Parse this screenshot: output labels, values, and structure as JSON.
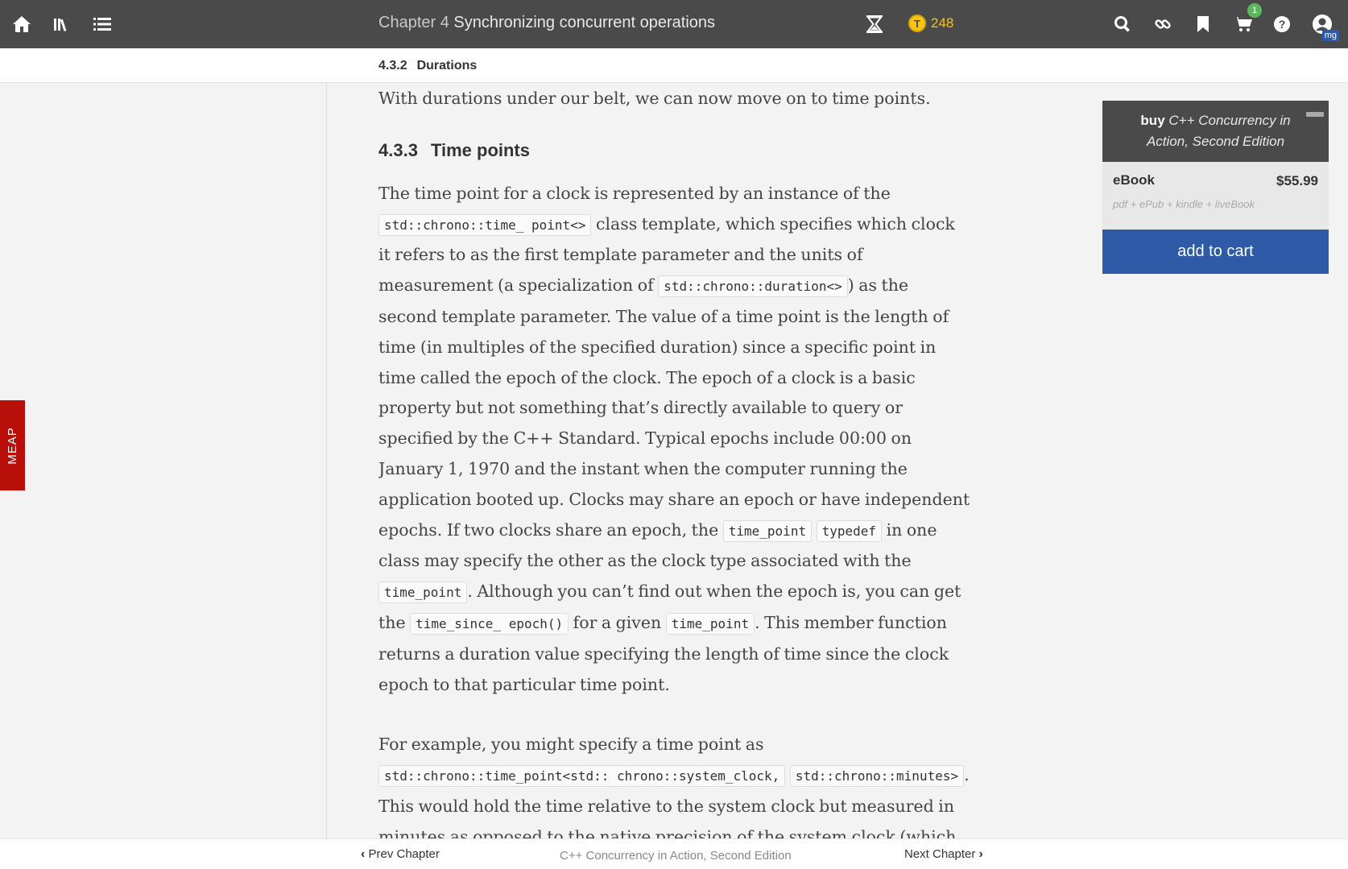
{
  "topbar": {
    "chapter_prefix": "Chapter 4",
    "chapter_title": "Synchronizing concurrent operations",
    "token_count": "248",
    "token_symbol": "T",
    "cart_count": "1",
    "avatar_initials": "mg",
    "icons": [
      "home-icon",
      "library-icon",
      "toc-list-icon",
      "hourglass-icon",
      "search-icon",
      "link-icon",
      "bookmark-icon",
      "cart-icon",
      "help-icon",
      "user-icon"
    ]
  },
  "subheader": {
    "section_number": "4.3.2",
    "section_title": "Durations"
  },
  "meap": {
    "label": "MEAP"
  },
  "content": {
    "intro": "With durations under our belt, we can now move on to time points.",
    "heading_number": "4.3.3",
    "heading_title": "Time points",
    "p1": {
      "t1": "The time point for a clock is represented by an instance of the ",
      "c1": "std::chrono::time_ point<>",
      "t2": " class template, which specifies which clock it refers to as the first template parameter and the units of measurement (a specialization of ",
      "c2": "std::chrono::duration<>",
      "t3": ") as the second template parameter. The value of a time point is the length of time (in multiples of the specified duration) since a specific point in time called the epoch of the clock. The epoch of a clock is a basic property but not something that’s directly available to query or specified by the C++ Standard. Typical epochs include 00:00 on January 1, 1970 and the instant when the computer running the application booted up. Clocks may share an epoch or have independent epochs. If two clocks share an epoch, the ",
      "c3": "time_point",
      "t4": " ",
      "c4": "typedef",
      "t5": " in one class may specify the other as the clock type associated with the ",
      "c5": "time_point",
      "t6": ". Although you can’t find out when the epoch is, you can get the ",
      "c6": "time_since_ epoch()",
      "t7": " for a given ",
      "c7": "time_point",
      "t8": ". This member function returns a duration value specifying the length of time since the clock epoch to that particular time point."
    },
    "p2": {
      "t1": "For example, you might specify a time point as ",
      "c1": "std::chrono::time_point<std:: chrono::system_clock,",
      "t2": " ",
      "c2": "std::chrono::minutes>",
      "t3": ". This would hold the time relative to the system clock but measured in minutes as opposed to the native precision of the system clock (which is typically seconds or less)."
    }
  },
  "buybox": {
    "buy_label": "buy",
    "book_title": "C++ Concurrency in Action, Second Edition",
    "format": "eBook",
    "price": "$55.99",
    "formats": "pdf + ePub + kindle + liveBook",
    "add_to_cart": "add to cart"
  },
  "footer": {
    "prev": "Prev Chapter",
    "book_title": "C++ Concurrency in Action, Second Edition",
    "next": "Next Chapter"
  },
  "colors": {
    "topbar": "#4a4a4a",
    "accent_blue": "#2f5aa8",
    "meap_red": "#b80f0a",
    "token_gold": "#f5c518",
    "badge_green": "#5cb85c"
  }
}
